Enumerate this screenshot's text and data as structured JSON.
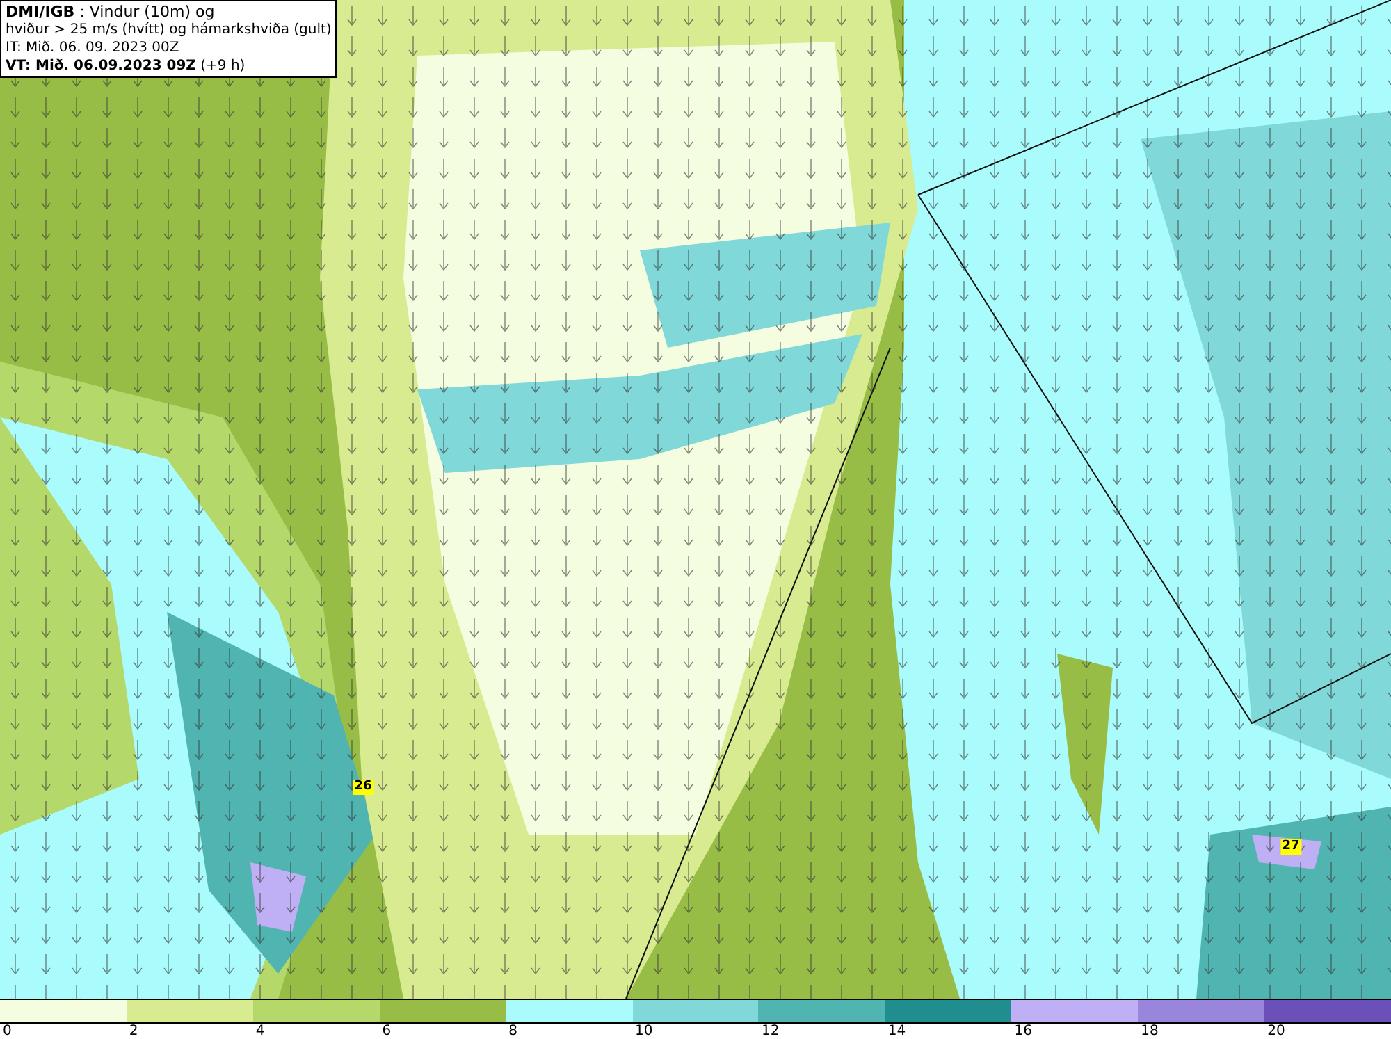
{
  "title_box": {
    "lines": [
      "**DMI/IGB** : Vindur (10m) og",
      "hviður > 25 m/s (hvítt) og hámarkshviða (gult)",
      "IT: Mið. 06. 09. 2023 00Z",
      "**VT: Mið. 06.09.2023 09Z** (+9 h)"
    ]
  },
  "map": {
    "gust_labels": [
      "26",
      "27"
    ]
  },
  "legend": {
    "bins": [
      {
        "color": "#f5fde0"
      },
      {
        "color": "#d8eb90"
      },
      {
        "color": "#b5d86a"
      },
      {
        "color": "#98bd47"
      },
      {
        "color": "#aafcfc"
      },
      {
        "color": "#80d8d8"
      },
      {
        "color": "#50b4b0"
      },
      {
        "color": "#208e8e"
      },
      {
        "color": "#bfb0f5"
      },
      {
        "color": "#9a85dd"
      },
      {
        "color": "#6a50b8"
      }
    ],
    "labels": [
      "0",
      "2",
      "4",
      "6",
      "8",
      "10",
      "12",
      "14",
      "16",
      "18",
      "20"
    ]
  }
}
